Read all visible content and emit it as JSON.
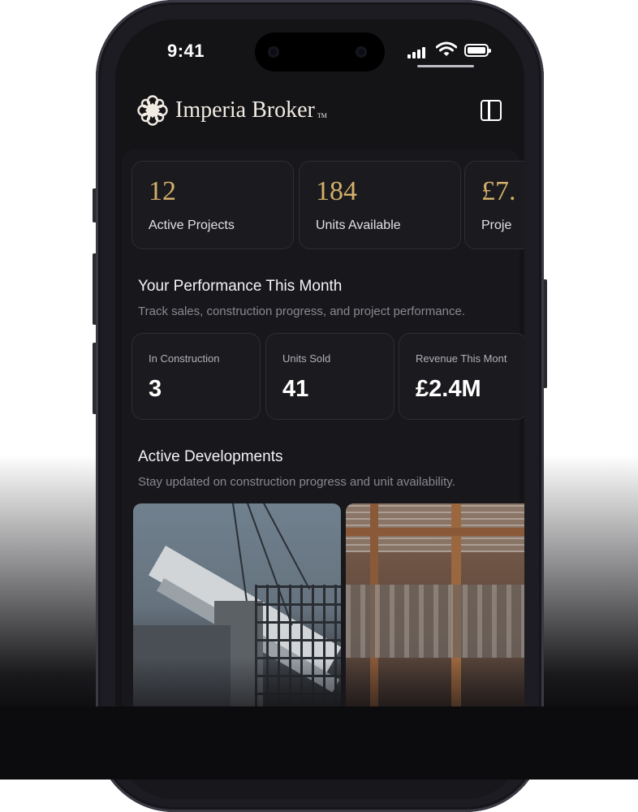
{
  "status_bar": {
    "time": "9:41"
  },
  "app": {
    "brand_name": "Imperia Broker",
    "trademark": "TM"
  },
  "kpis": [
    {
      "value": "12",
      "label": "Active Projects"
    },
    {
      "value": "184",
      "label": "Units Available"
    },
    {
      "value": "£7.",
      "label": "Proje"
    }
  ],
  "performance": {
    "title": "Your Performance This Month",
    "subtitle": "Track sales, construction progress, and project performance.",
    "stats": [
      {
        "label": "In Construction",
        "value": "3"
      },
      {
        "label": "Units Sold",
        "value": "41"
      },
      {
        "label": "Revenue This Mont",
        "value": "£2.4M"
      }
    ]
  },
  "developments": {
    "title": "Active Developments",
    "subtitle": "Stay updated on construction progress and unit availability.",
    "photos": [
      "construction-crane-photo",
      "building-interior-photo"
    ]
  },
  "colors": {
    "accent_gold": "#d4b06a",
    "screen_bg": "#141316",
    "card_border": "#2e2d34"
  }
}
